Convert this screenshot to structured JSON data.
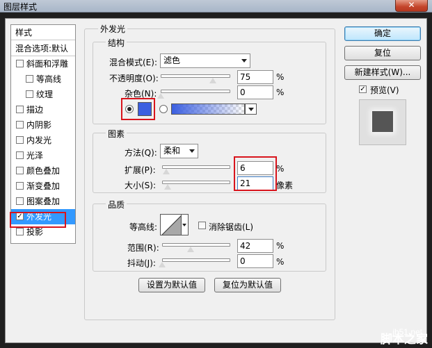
{
  "window": {
    "title": "图层样式",
    "close_glyph": "✕"
  },
  "sidebar": {
    "header": "样式",
    "items": [
      {
        "label": "混合选项:默认",
        "checkbox": false,
        "checked": false
      },
      {
        "label": "斜面和浮雕",
        "checkbox": true,
        "checked": false
      },
      {
        "label": "等高线",
        "checkbox": true,
        "checked": false,
        "sub": true
      },
      {
        "label": "纹理",
        "checkbox": true,
        "checked": false,
        "sub": true
      },
      {
        "label": "描边",
        "checkbox": true,
        "checked": false
      },
      {
        "label": "内阴影",
        "checkbox": true,
        "checked": false
      },
      {
        "label": "内发光",
        "checkbox": true,
        "checked": false
      },
      {
        "label": "光泽",
        "checkbox": true,
        "checked": false
      },
      {
        "label": "颜色叠加",
        "checkbox": true,
        "checked": false
      },
      {
        "label": "渐变叠加",
        "checkbox": true,
        "checked": false
      },
      {
        "label": "图案叠加",
        "checkbox": true,
        "checked": false
      },
      {
        "label": "外发光",
        "checkbox": true,
        "checked": true,
        "selected": true
      },
      {
        "label": "投影",
        "checkbox": true,
        "checked": false
      }
    ]
  },
  "panel": {
    "title": "外发光",
    "structure": {
      "title": "结构",
      "blend_mode_label": "混合模式(E):",
      "blend_mode_value": "滤色",
      "opacity_label": "不透明度(O):",
      "opacity_value": "75",
      "opacity_fraction": 0.75,
      "noise_label": "杂色(N):",
      "noise_value": "0",
      "noise_fraction": 0.0,
      "color_swatch": "#3b5fe0",
      "unit": "%"
    },
    "elements": {
      "title": "图素",
      "method_label": "方法(Q):",
      "method_value": "柔和",
      "spread_label": "扩展(P):",
      "spread_value": "6",
      "spread_fraction": 0.06,
      "size_label": "大小(S):",
      "size_value": "21",
      "size_fraction": 0.084,
      "spread_unit": "%",
      "size_unit": "像素"
    },
    "quality": {
      "title": "品质",
      "contour_label": "等高线:",
      "antialias_label": "消除锯齿(L)",
      "range_label": "范围(R):",
      "range_value": "42",
      "range_fraction": 0.42,
      "jitter_label": "抖动(J):",
      "jitter_value": "0",
      "jitter_fraction": 0.0,
      "unit": "%"
    },
    "make_default": "设置为默认值",
    "reset_default": "复位为默认值"
  },
  "buttons": {
    "ok": "确定",
    "reset": "复位",
    "new_style": "新建样式(W)...",
    "preview": "预览(V)",
    "preview_checked": true
  },
  "watermark": {
    "line1": "jb51.net",
    "line2": "脚本之家"
  },
  "colors": {
    "accent": "#3399ff",
    "highlight_red": "#d8141c",
    "glow": "#3b5fe0"
  }
}
